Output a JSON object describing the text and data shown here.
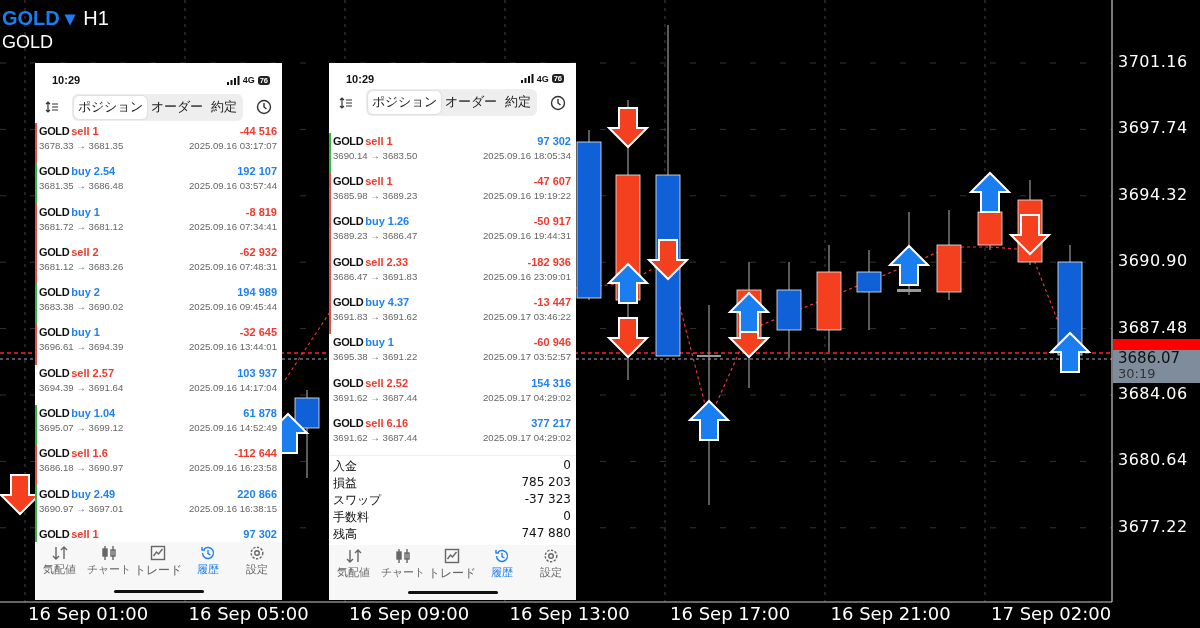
{
  "chart": {
    "symbol": "GOLD",
    "symbol_menu": "▾",
    "timeframe": "H1",
    "subtitle": "GOLD",
    "price_labels": [
      "3701.16",
      "3697.74",
      "3694.32",
      "3690.90",
      "3687.48",
      "3684.06",
      "3680.64",
      "3677.22"
    ],
    "current_price": "3686.07",
    "countdown": "30:19",
    "time_labels": [
      "16 Sep 01:00",
      "16 Sep 05:00",
      "16 Sep 09:00",
      "16 Sep 13:00",
      "16 Sep 17:00",
      "16 Sep 21:00",
      "17 Sep 02:00"
    ]
  },
  "phones": [
    {
      "time": "10:29",
      "network": "4G",
      "battery": "76",
      "segments": [
        {
          "label": "ポジション",
          "selected": true
        },
        {
          "label": "オーダー",
          "selected": false
        },
        {
          "label": "約定",
          "selected": false
        }
      ],
      "rows": [
        {
          "symbol": "GOLD",
          "kind": "sell",
          "order": "sell 1",
          "profit": "-44 516",
          "color": "#ee3a2c",
          "bar": {
            "color": "#e0524a"
          },
          "prices": "3678.33 → 3681.35",
          "time": "2025.09.16 03:17:07"
        },
        {
          "symbol": "GOLD",
          "kind": "buy",
          "order": "buy 2.54",
          "profit": "192 107",
          "color": "#1f80f0",
          "bar": {
            "color": "#3bb54a"
          },
          "prices": "3681.35 → 3686.48",
          "time": "2025.09.16 03:57:44"
        },
        {
          "symbol": "GOLD",
          "kind": "buy",
          "order": "buy 1",
          "profit": "-8 819",
          "color": "#ee3a2c",
          "bar": {
            "color": "#e0524a"
          },
          "prices": "3681.72 → 3681.12",
          "time": "2025.09.16 07:34:41"
        },
        {
          "symbol": "GOLD",
          "kind": "sell",
          "order": "sell 2",
          "profit": "-62 932",
          "color": "#ee3a2c",
          "bar": {
            "color": "#e0524a"
          },
          "prices": "3681.12 → 3683.26",
          "time": "2025.09.16 07:48:31"
        },
        {
          "symbol": "GOLD",
          "kind": "buy",
          "order": "buy 2",
          "profit": "194 989",
          "color": "#1f80f0",
          "bar": {
            "color": "#3bb54a"
          },
          "prices": "3683.38 → 3690.02",
          "time": "2025.09.16 09:45:44"
        },
        {
          "symbol": "GOLD",
          "kind": "buy",
          "order": "buy 1",
          "profit": "-32 645",
          "color": "#ee3a2c",
          "bar": {
            "color": "#e0524a"
          },
          "prices": "3696.61 → 3694.39",
          "time": "2025.09.16 13:44:01"
        },
        {
          "symbol": "GOLD",
          "kind": "sell",
          "order": "sell 2.57",
          "profit": "103 937",
          "color": "#1f80f0",
          "prices": "3694.39 → 3691.64",
          "time": "2025.09.16 14:17:04"
        },
        {
          "symbol": "GOLD",
          "kind": "buy",
          "order": "buy 1.04",
          "profit": "61 878",
          "color": "#1f80f0",
          "bar": {
            "color": "#3bb54a"
          },
          "prices": "3695.07 → 3699.12",
          "time": "2025.09.16 14:52:49"
        },
        {
          "symbol": "GOLD",
          "kind": "sell",
          "order": "sell 1.6",
          "profit": "-112 644",
          "color": "#ee3a2c",
          "bar": {
            "color": "#e0524a"
          },
          "prices": "3686.18 → 3690.97",
          "time": "2025.09.16 16:23:58"
        },
        {
          "symbol": "GOLD",
          "kind": "buy",
          "order": "buy 2.49",
          "profit": "220 866",
          "color": "#1f80f0",
          "bar": {
            "color": "#3bb54a"
          },
          "prices": "3690.97 → 3697.01",
          "time": "2025.09.16 16:38:15"
        },
        {
          "symbol": "GOLD",
          "kind": "sell",
          "order": "sell 1",
          "profit": "97 302",
          "color": "#1f80f0",
          "bar": {
            "color": "#3bb54a"
          }
        }
      ],
      "tabs": [
        {
          "label": "気配値",
          "selected": false
        },
        {
          "label": "チャート",
          "selected": false
        },
        {
          "label": "トレード",
          "selected": false
        },
        {
          "label": "履歴",
          "selected": true
        },
        {
          "label": "設定",
          "selected": false
        }
      ]
    },
    {
      "time": "10:29",
      "network": "4G",
      "battery": "76",
      "segments": [
        {
          "label": "ポジション",
          "selected": true
        },
        {
          "label": "オーダー",
          "selected": false
        },
        {
          "label": "約定",
          "selected": false
        }
      ],
      "rows": [
        {
          "symbol": "GOLD",
          "kind": "sell",
          "order": "sell 1",
          "profit": "97 302",
          "color": "#1f80f0",
          "bar": {
            "color": "#3bb54a"
          },
          "prices": "3690.14 → 3683.50",
          "time": "2025.09.16 18:05:34"
        },
        {
          "symbol": "GOLD",
          "kind": "sell",
          "order": "sell 1",
          "profit": "-47 607",
          "color": "#ee3a2c",
          "bar": {
            "color": "#e0524a"
          },
          "prices": "3685.98 → 3689.23",
          "time": "2025.09.16 19:19:22"
        },
        {
          "symbol": "GOLD",
          "kind": "buy",
          "order": "buy 1.26",
          "profit": "-50 917",
          "color": "#ee3a2c",
          "bar": {
            "color": "#e0524a"
          },
          "prices": "3689.23 → 3686.47",
          "time": "2025.09.16 19:44:31"
        },
        {
          "symbol": "GOLD",
          "kind": "sell",
          "order": "sell 2.33",
          "profit": "-182 936",
          "color": "#ee3a2c",
          "bar": {
            "color": "#e0524a"
          },
          "prices": "3686.47 → 3691.83",
          "time": "2025.09.16 23:09:01"
        },
        {
          "symbol": "GOLD",
          "kind": "buy",
          "order": "buy 4.37",
          "profit": "-13 447",
          "color": "#ee3a2c",
          "bar": {
            "color": "#e0524a"
          },
          "prices": "3691.83 → 3691.62",
          "time": "2025.09.17 03:46:22"
        },
        {
          "symbol": "GOLD",
          "kind": "buy",
          "order": "buy 1",
          "profit": "-60 946",
          "color": "#ee3a2c",
          "prices": "3695.38 → 3691.22",
          "time": "2025.09.17 03:52:57"
        },
        {
          "symbol": "GOLD",
          "kind": "sell",
          "order": "sell 2.52",
          "profit": "154 316",
          "color": "#1f80f0",
          "prices": "3691.62 → 3687.44",
          "time": "2025.09.17 04:29:02"
        },
        {
          "symbol": "GOLD",
          "kind": "sell",
          "order": "sell 6.16",
          "profit": "377 217",
          "color": "#1f80f0",
          "prices": "3691.62 → 3687.44",
          "time": "2025.09.17 04:29:02"
        }
      ],
      "summary": [
        {
          "label": "入金",
          "value": "0"
        },
        {
          "label": "損益",
          "value": "785 203"
        },
        {
          "label": "スワップ",
          "value": "-37 323"
        },
        {
          "label": "手数料",
          "value": "0"
        },
        {
          "label": "残高",
          "value": "747 880"
        }
      ],
      "tabs": [
        {
          "label": "気配値",
          "selected": false
        },
        {
          "label": "チャート",
          "selected": false
        },
        {
          "label": "トレード",
          "selected": false
        },
        {
          "label": "履歴",
          "selected": true
        },
        {
          "label": "設定",
          "selected": false
        }
      ]
    }
  ]
}
